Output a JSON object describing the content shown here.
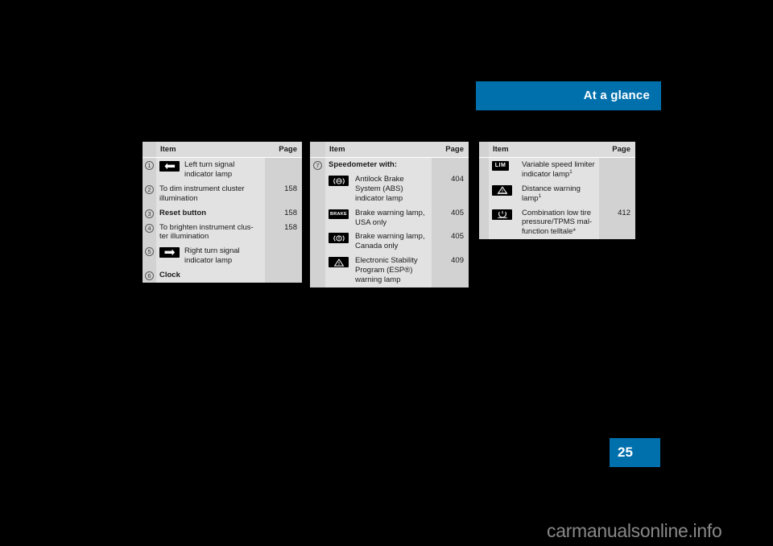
{
  "header": {
    "title": "At a glance"
  },
  "page_number": "25",
  "watermark": "carmanualsonline.info",
  "tables": [
    {
      "name": "instrument-cluster-left",
      "columns": {
        "item": "Item",
        "page": "Page"
      },
      "rows": [
        {
          "num": "1",
          "icon": "turn-signal-left-icon",
          "text": "Left turn signal indicator lamp",
          "page": "",
          "bold": false
        },
        {
          "num": "2",
          "icon": "",
          "text": "To dim instrument cluster illumination",
          "page": "158",
          "bold": false
        },
        {
          "num": "3",
          "icon": "",
          "text": "Reset button",
          "page": "158",
          "bold": true
        },
        {
          "num": "4",
          "icon": "",
          "text": "To brighten instrument clus-ter illumination",
          "page": "158",
          "bold": false
        },
        {
          "num": "5",
          "icon": "turn-signal-right-icon",
          "text": "Right turn signal indicator lamp",
          "page": "",
          "bold": false
        },
        {
          "num": "6",
          "icon": "",
          "text": "Clock",
          "page": "",
          "bold": true
        }
      ]
    },
    {
      "name": "speedometer-telltales",
      "columns": {
        "item": "Item",
        "page": "Page"
      },
      "rows": [
        {
          "num": "7",
          "icon": "",
          "text": "Speedometer with:",
          "page": "",
          "bold": true
        },
        {
          "num": "",
          "icon": "abs-icon",
          "text": "Antilock Brake System (ABS) indicator lamp",
          "page": "404",
          "bold": false
        },
        {
          "num": "",
          "icon": "brake-text-icon",
          "text": "Brake warning lamp, USA only",
          "page": "405",
          "bold": false
        },
        {
          "num": "",
          "icon": "brake-circle-icon",
          "text": "Brake warning lamp, Canada only",
          "page": "405",
          "bold": false
        },
        {
          "num": "",
          "icon": "esp-triangle-icon",
          "text": "Electronic Stability Program (ESP®) warning lamp",
          "page": "409",
          "bold": false
        }
      ]
    },
    {
      "name": "additional-telltales",
      "columns": {
        "item": "Item",
        "page": "Page"
      },
      "rows": [
        {
          "num": "",
          "icon": "lim-icon",
          "text": "Variable speed limiter indicator lamp",
          "footnote": "1",
          "page": "",
          "bold": false
        },
        {
          "num": "",
          "icon": "distance-warning-icon",
          "text": "Distance warning lamp",
          "footnote": "1",
          "page": "",
          "bold": false
        },
        {
          "num": "",
          "icon": "tire-pressure-icon",
          "text": "Combination low tire pressure/TPMS mal-function telltale*",
          "page": "412",
          "bold": false
        }
      ]
    }
  ],
  "icon_labels": {
    "lim": "LIM",
    "brake": "BRAKE"
  },
  "colors": {
    "accent": "#0070ad",
    "background": "#000000",
    "table_body": "#e2e2e2",
    "table_side": "#d2d2d2",
    "table_header": "#dcdcdc"
  }
}
